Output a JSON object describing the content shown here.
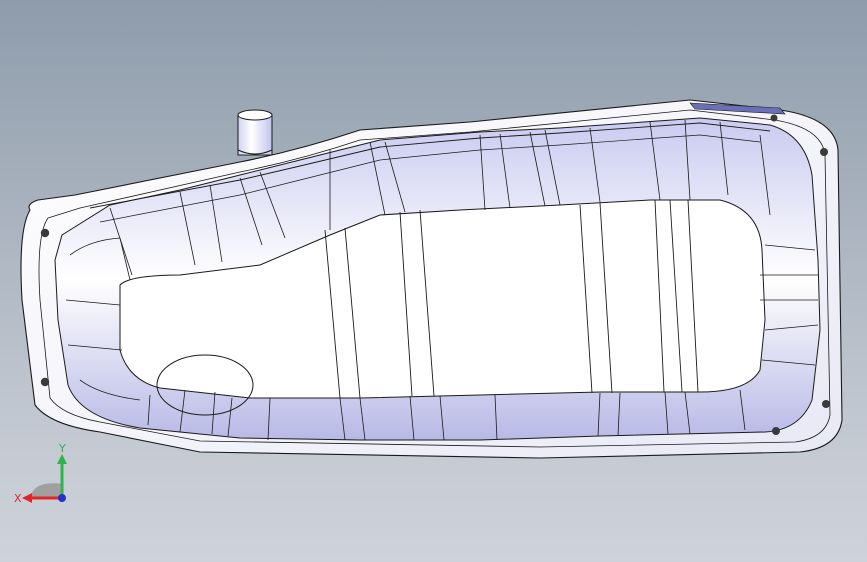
{
  "viewport": {
    "background_top": "#8e9cab",
    "background_bottom": "#ced3db",
    "model": {
      "part_name_icon": "oil-pan-icon",
      "edge_color": "#1a1a1a",
      "face_color_light": "#ffffff",
      "face_color_shadow": "#b8b9e6",
      "highlight_color": "#6b6fb8"
    }
  },
  "triad": {
    "x_label": "X",
    "y_label": "Y",
    "x_color": "#e0262a",
    "y_color": "#2fb34a",
    "z_color": "#2233cc"
  }
}
